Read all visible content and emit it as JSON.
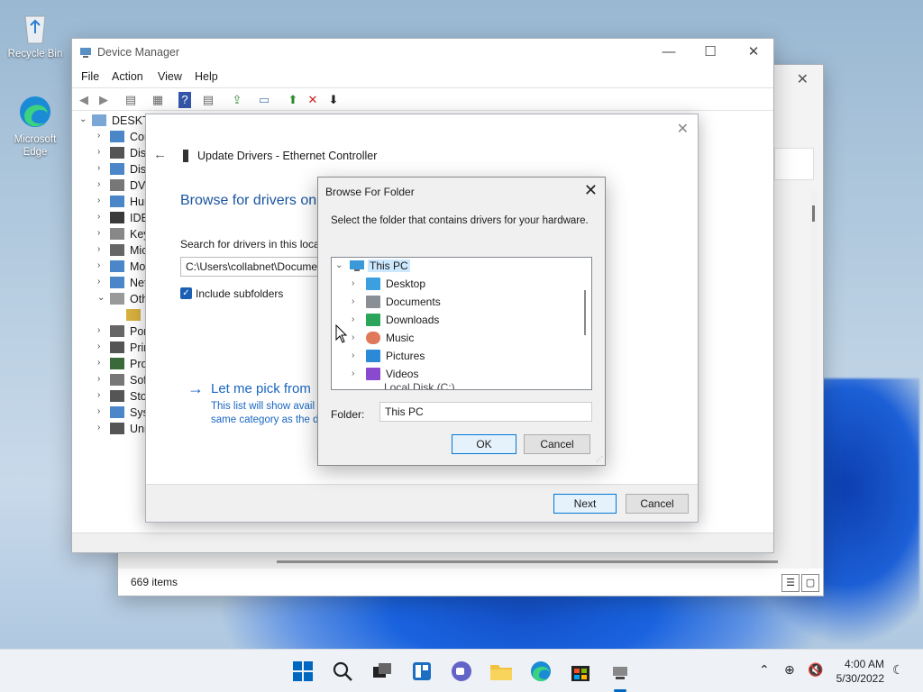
{
  "desktop": {
    "icons": [
      {
        "label": "Recycle Bin",
        "icon": "recycle-bin-icon"
      },
      {
        "label": "Microsoft Edge",
        "icon": "edge-icon"
      }
    ]
  },
  "explorer_bg": {
    "status": "669 items"
  },
  "device_manager": {
    "title": "Device Manager",
    "menu": [
      "File",
      "Action",
      "View",
      "Help"
    ],
    "tree_root": "DESKTO",
    "tree_items": [
      "Cor",
      "Disk",
      "Disp",
      "DVD",
      "Hun",
      "IDE",
      "Key",
      "Mic",
      "Mo",
      "Net",
      "Oth",
      "",
      "Por",
      "Prin",
      "Pro",
      "Soft",
      "Stor",
      "Syst",
      "Uni"
    ]
  },
  "wizard": {
    "header": "Update Drivers - Ethernet Controller",
    "heading": "Browse for drivers on",
    "search_label": "Search for drivers in this locat",
    "path_value": "C:\\Users\\collabnet\\Docume",
    "include_subfolders": "Include subfolders",
    "pick_link": "Let me pick from",
    "pick_desc_1": "This list will show avail",
    "pick_desc_2": "same category as the d",
    "next": "Next",
    "cancel": "Cancel"
  },
  "browse_dialog": {
    "title": "Browse For Folder",
    "instruction": "Select the folder that contains drivers for your hardware.",
    "root": "This PC",
    "folders": [
      "Desktop",
      "Documents",
      "Downloads",
      "Music",
      "Pictures",
      "Videos"
    ],
    "partial": "Local Disk (C:)",
    "folder_label": "Folder:",
    "folder_value": "This PC",
    "ok": "OK",
    "cancel": "Cancel"
  },
  "taskbar": {
    "time": "4:00 AM",
    "date": "5/30/2022",
    "accent": "#0067c0"
  }
}
